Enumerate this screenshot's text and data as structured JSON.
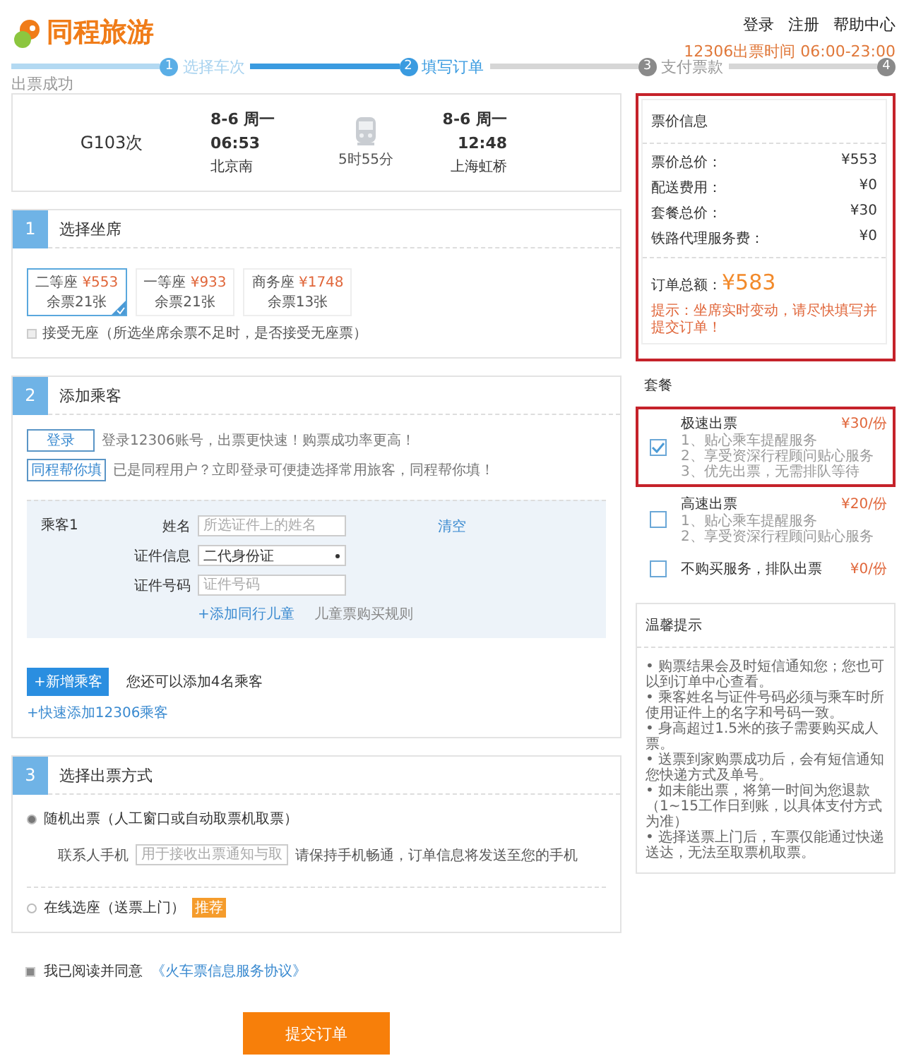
{
  "header": {
    "logo": "同程旅游",
    "links": [
      "登录",
      "注册",
      "帮助中心"
    ],
    "notice": "12306出票时间 06:00-23:00"
  },
  "steps": [
    {
      "number": "1",
      "label": "选择车次",
      "current": false
    },
    {
      "number": "2",
      "label": "填写订单",
      "current": true
    },
    {
      "number": "3",
      "label": "支付票款",
      "current": false
    },
    {
      "number": "4",
      "label": "出票成功",
      "current": false
    }
  ],
  "train": {
    "number": "G103次",
    "depart": {
      "date": "8-6 周一",
      "time": "06:53",
      "station": "北京南"
    },
    "duration": "5时55分",
    "arrive": {
      "date": "8-6 周一",
      "time": "12:48",
      "station": "上海虹桥"
    }
  },
  "seat_section": {
    "number": "1",
    "title": "选择坐席",
    "seats": [
      {
        "name": "二等座",
        "price": "¥553",
        "remaining": "余票21张",
        "selected": true
      },
      {
        "name": "一等座",
        "price": "¥933",
        "remaining": "余票21张",
        "selected": false
      },
      {
        "name": "商务座",
        "price": "¥1748",
        "remaining": "余票13张",
        "selected": false
      }
    ],
    "accept_no_seat": {
      "label": "接受无座（所选坐席余票不足时，是否接受无座票）",
      "checked": false
    }
  },
  "passenger_section": {
    "number": "2",
    "title": "添加乘客",
    "prompts": [
      {
        "button": "登录",
        "text": "登录12306账号，出票更快速！购票成功率更高！"
      },
      {
        "button": "同程帮你填",
        "text": "已是同程用户？立即登录可便捷选择常用旅客，同程帮你填！"
      }
    ],
    "passenger": {
      "label": "乘客1",
      "clear": "清空",
      "fields": [
        {
          "kind": "text",
          "label": "姓名",
          "placeholder": "所选证件上的姓名"
        },
        {
          "kind": "select",
          "label": "证件信息",
          "value": "二代身份证"
        },
        {
          "kind": "text",
          "label": "证件号码",
          "placeholder": "证件号码"
        }
      ],
      "links": [
        "+添加同行儿童",
        "儿童票购买规则"
      ]
    },
    "add_button": "+新增乘客",
    "add_note": "您还可以添加4名乘客",
    "quick_add": "+快速添加12306乘客"
  },
  "delivery_section": {
    "number": "3",
    "title": "选择出票方式",
    "options": [
      {
        "label": "随机出票（人工窗口或自动取票机取票）",
        "selected": true,
        "phone": {
          "label": "联系人手机",
          "placeholder": "用于接收出票通知与取",
          "note": "请保持手机畅通，订单信息将发送至您的手机"
        }
      },
      {
        "label": "在线选座（送票上门）",
        "selected": false,
        "badge": "推荐"
      }
    ]
  },
  "agreement": {
    "checked": true,
    "text": "我已阅读并同意",
    "link": "《火车票信息服务协议》"
  },
  "submit": "提交订单",
  "price_info": {
    "title": "票价信息",
    "items": [
      {
        "label": "票价总价：",
        "value": "¥553"
      },
      {
        "label": "配送费用：",
        "value": "¥0"
      },
      {
        "label": "套餐总价：",
        "value": "¥30"
      },
      {
        "label": "铁路代理服务费：",
        "value": "¥0"
      }
    ],
    "total_label": "订单总额：",
    "total": "¥583",
    "hint": "提示：坐席实时变动，请尽快填写并提交订单！"
  },
  "packages": {
    "title": "套餐",
    "items": [
      {
        "name": "极速出票",
        "price": "¥30/份",
        "features": [
          "1、贴心乘车提醒服务",
          "2、享受资深行程顾问贴心服务",
          "3、优先出票，无需排队等待"
        ],
        "selected": true
      },
      {
        "name": "高速出票",
        "price": "¥20/份",
        "features": [
          "1、贴心乘车提醒服务",
          "2、享受资深行程顾问贴心服务"
        ],
        "selected": false
      },
      {
        "name": "不购买服务，排队出票",
        "price": "¥0/份",
        "selected": false
      }
    ]
  },
  "tips": {
    "title": "温馨提示",
    "items": [
      "• 购票结果会及时短信通知您；您也可以到订单中心查看。",
      "• 乘客姓名与证件号码必须与乘车时所使用证件上的名字和号码一致。",
      "• 身高超过1.5米的孩子需要购买成人票。",
      "• 送票到家购票成功后，会有短信通知您快递方式及单号。",
      "• 如未能出票，将第一时间为您退款（1~15工作日到账，以具体支付方式为准）",
      "• 选择送票上门后，车票仅能通过快递送达，无法至取票机取票。"
    ]
  }
}
